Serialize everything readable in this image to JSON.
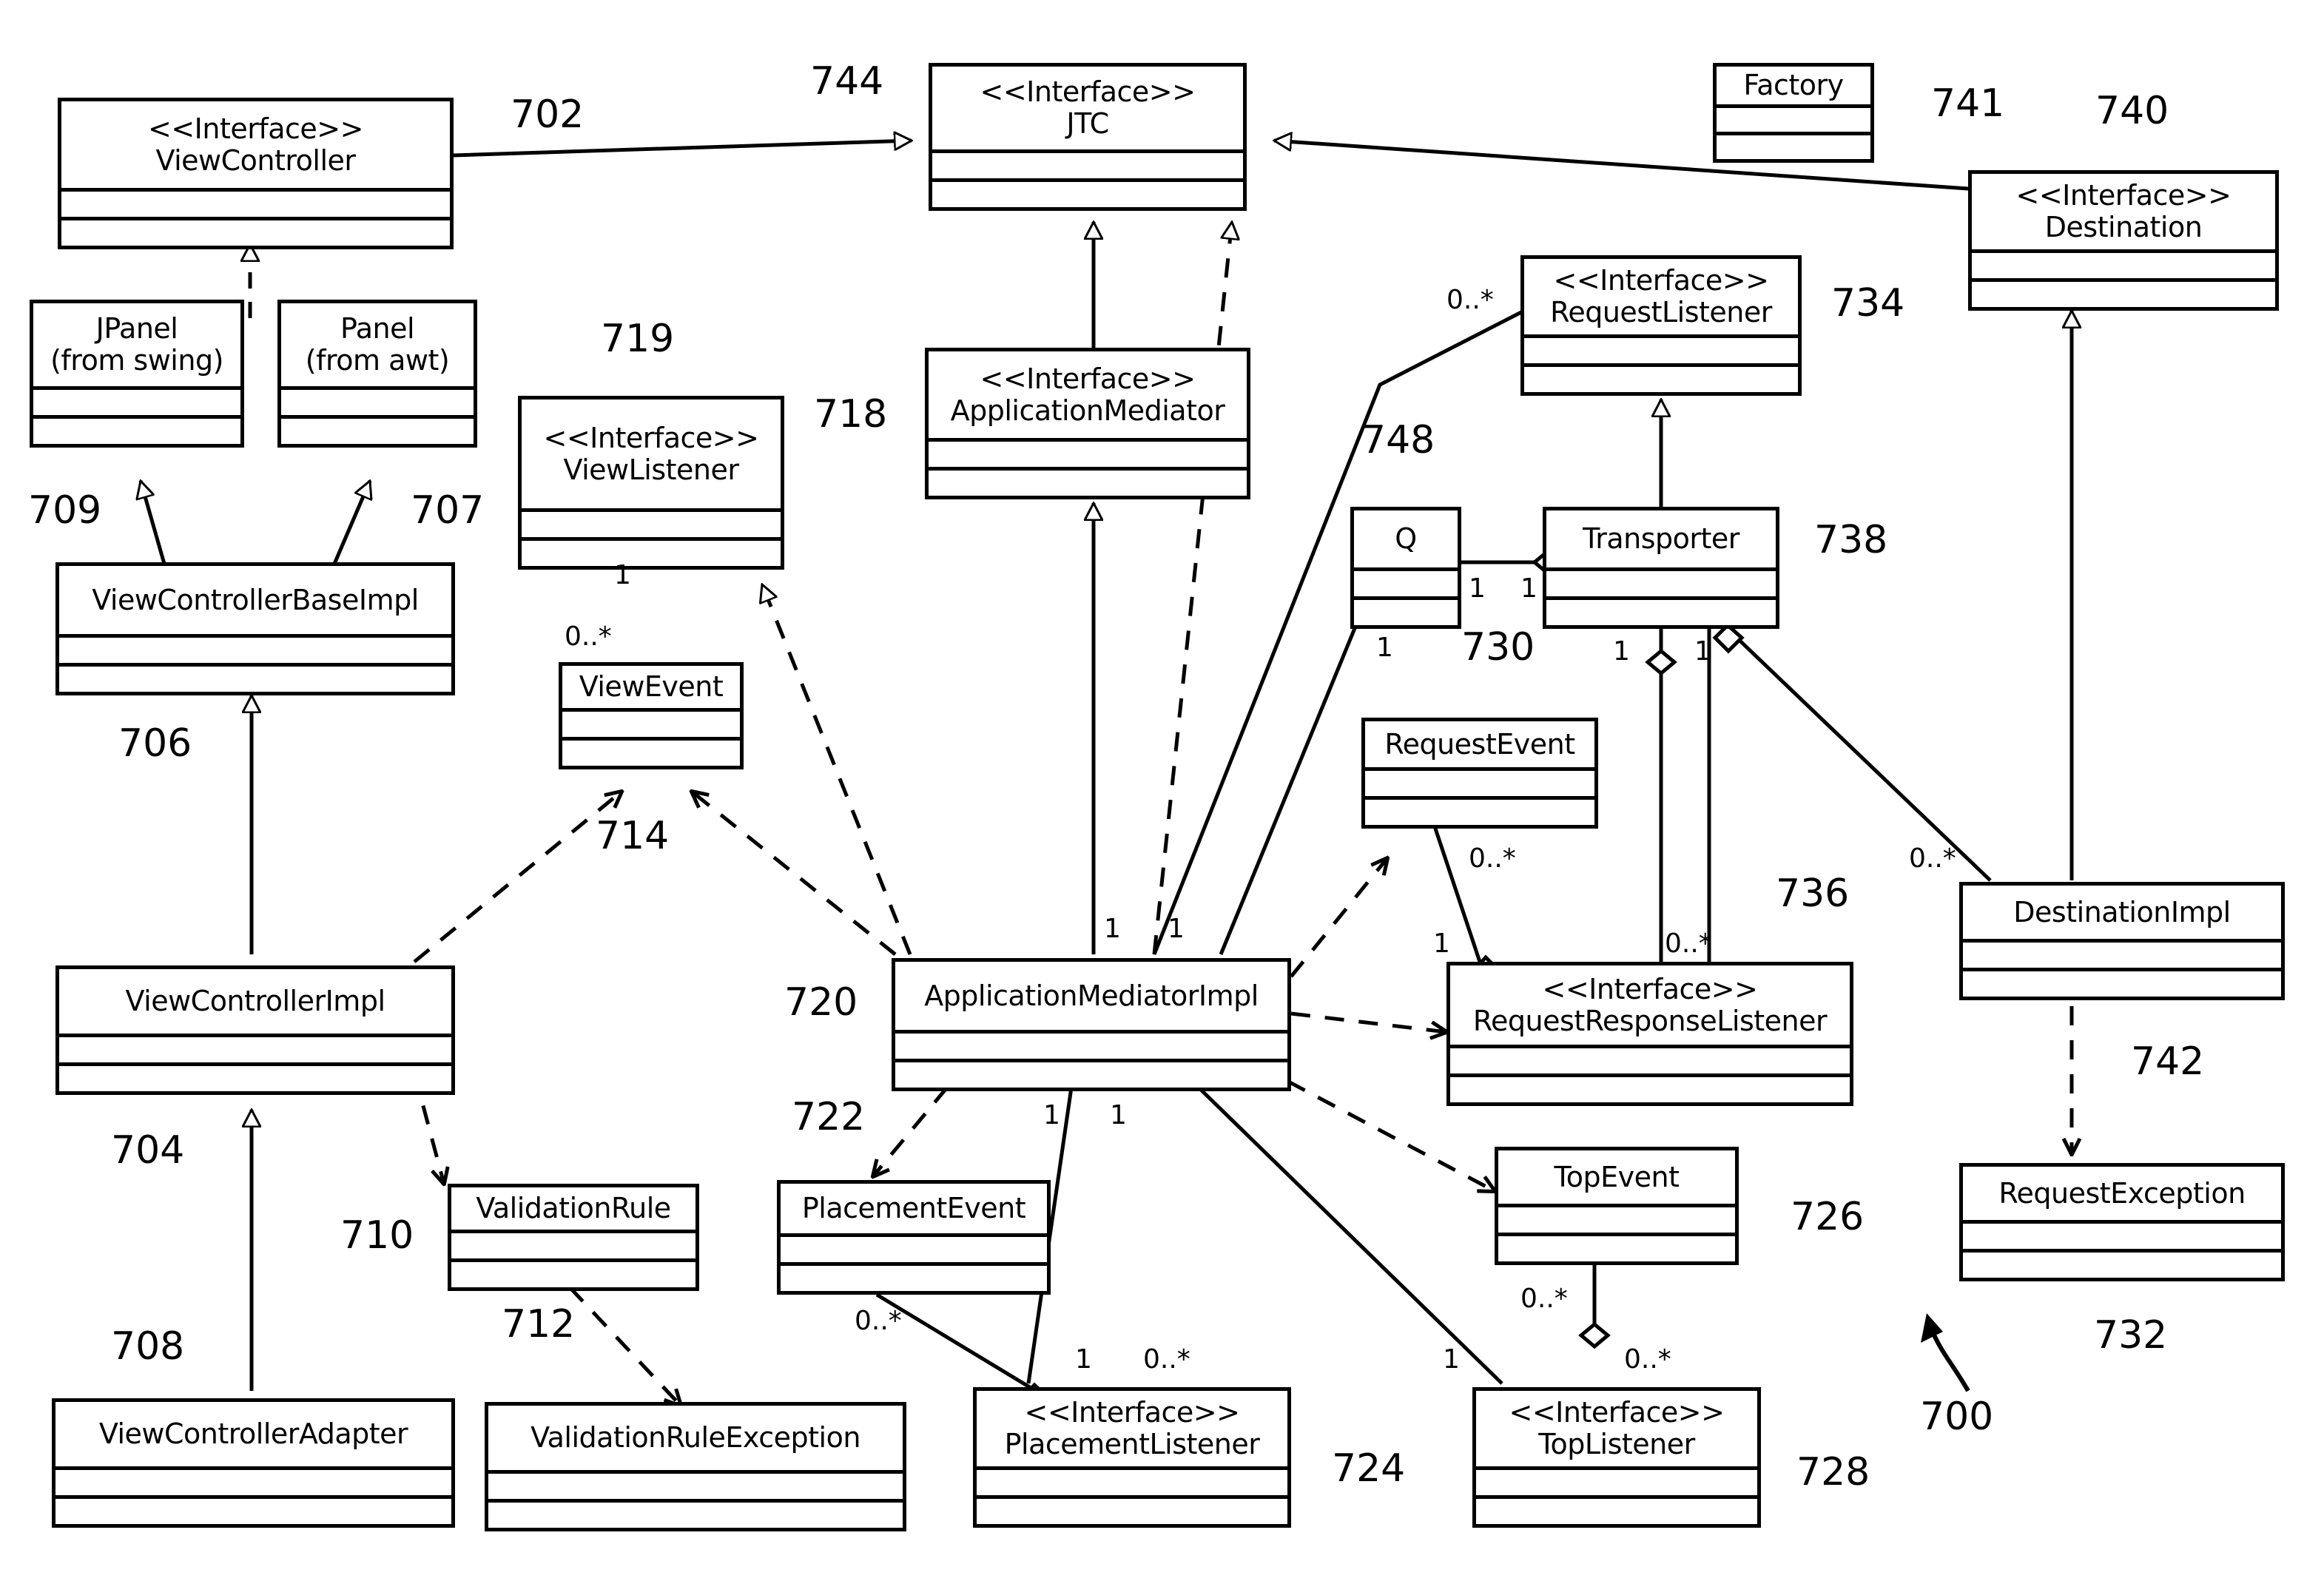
{
  "diagram": {
    "title": "UML class diagram",
    "figure_label": "700"
  },
  "classes": [
    {
      "id": "viewController",
      "stereotype": "<<Interface>>",
      "name": "ViewController",
      "ref": "702"
    },
    {
      "id": "jpanel",
      "stereotype": "",
      "name": "JPanel",
      "name2": "(from swing)",
      "ref": "709"
    },
    {
      "id": "panel",
      "stereotype": "",
      "name": "Panel",
      "name2": "(from awt)",
      "ref": "707"
    },
    {
      "id": "viewControllerBaseImpl",
      "stereotype": "",
      "name": "ViewControllerBaseImpl",
      "ref": "706"
    },
    {
      "id": "viewControllerImpl",
      "stereotype": "",
      "name": "ViewControllerImpl",
      "ref": "704"
    },
    {
      "id": "viewControllerAdapter",
      "stereotype": "",
      "name": "ViewControllerAdapter",
      "ref": "708"
    },
    {
      "id": "validationRule",
      "stereotype": "",
      "name": "ValidationRule",
      "ref": "710"
    },
    {
      "id": "validationRuleException",
      "stereotype": "",
      "name": "ValidationRuleException",
      "ref": "712"
    },
    {
      "id": "viewListener",
      "stereotype": "<<Interface>>",
      "name": "ViewListener",
      "ref": "719"
    },
    {
      "id": "viewEvent",
      "stereotype": "",
      "name": "ViewEvent",
      "ref": "714"
    },
    {
      "id": "jtc",
      "stereotype": "<<Interface>>",
      "name": "JTC",
      "ref": "744"
    },
    {
      "id": "applicationMediator",
      "stereotype": "<<Interface>>",
      "name": "ApplicationMediator",
      "ref": "718"
    },
    {
      "id": "applicationMediatorImpl",
      "stereotype": "",
      "name": "ApplicationMediatorImpl",
      "ref": "720"
    },
    {
      "id": "placementEvent",
      "stereotype": "",
      "name": "PlacementEvent",
      "ref": "722"
    },
    {
      "id": "placementListener",
      "stereotype": "<<Interface>>",
      "name": "PlacementListener",
      "ref": "724"
    },
    {
      "id": "topEvent",
      "stereotype": "",
      "name": "TopEvent",
      "ref": "726"
    },
    {
      "id": "topListener",
      "stereotype": "<<Interface>>",
      "name": "TopListener",
      "ref": "728"
    },
    {
      "id": "requestEvent",
      "stereotype": "",
      "name": "RequestEvent",
      "ref": "730"
    },
    {
      "id": "requestException",
      "stereotype": "",
      "name": "RequestException",
      "ref": "732"
    },
    {
      "id": "requestListener",
      "stereotype": "<<Interface>>",
      "name": "RequestListener",
      "ref": "734"
    },
    {
      "id": "requestResponseListener",
      "stereotype": "<<Interface>>",
      "name": "RequestResponseListener",
      "ref": "736"
    },
    {
      "id": "transporter",
      "stereotype": "",
      "name": "Transporter",
      "ref": "738"
    },
    {
      "id": "destination",
      "stereotype": "<<Interface>>",
      "name": "Destination",
      "ref": "740"
    },
    {
      "id": "factory",
      "stereotype": "",
      "name": "Factory",
      "ref": "741"
    },
    {
      "id": "destinationImpl",
      "stereotype": "",
      "name": "DestinationImpl",
      "ref": "742"
    },
    {
      "id": "q",
      "stereotype": "",
      "name": "Q",
      "ref": "748"
    }
  ],
  "multiplicities": [
    {
      "id": "m1",
      "text": "0..*"
    },
    {
      "id": "m2",
      "text": "1"
    },
    {
      "id": "m3",
      "text": "0..*"
    },
    {
      "id": "m4",
      "text": "1"
    },
    {
      "id": "m5",
      "text": "1"
    },
    {
      "id": "m6",
      "text": "1"
    },
    {
      "id": "m7",
      "text": "1"
    },
    {
      "id": "m8",
      "text": "1"
    },
    {
      "id": "m9",
      "text": "1"
    },
    {
      "id": "m10",
      "text": "1"
    },
    {
      "id": "m11",
      "text": "0..*"
    },
    {
      "id": "m12",
      "text": "1"
    },
    {
      "id": "m13",
      "text": "0..*"
    },
    {
      "id": "m14",
      "text": "0..*"
    },
    {
      "id": "m15",
      "text": "0..*"
    },
    {
      "id": "m16",
      "text": "1"
    },
    {
      "id": "m17",
      "text": "0..*"
    },
    {
      "id": "m18",
      "text": "0..*"
    },
    {
      "id": "m19",
      "text": "1"
    },
    {
      "id": "m20",
      "text": "0..*"
    },
    {
      "id": "m21",
      "text": "1"
    },
    {
      "id": "m22",
      "text": "1"
    },
    {
      "id": "m23",
      "text": "1"
    }
  ]
}
